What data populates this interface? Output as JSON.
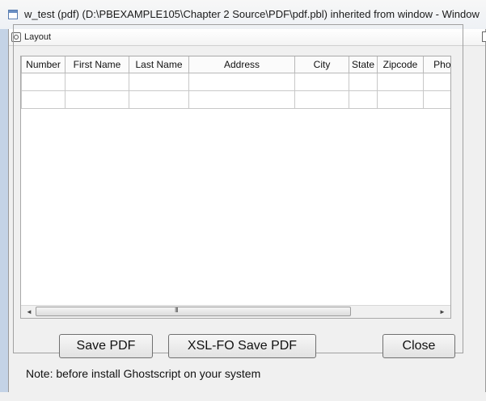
{
  "window": {
    "title": "w_test (pdf) (D:\\PBEXAMPLE105\\Chapter 2 Source\\PDF\\pdf.pbl) inherited from window - Window",
    "icon": "window-icon"
  },
  "layout_panel": {
    "title": "Layout",
    "icon": "layout-icon"
  },
  "grid": {
    "columns": [
      "Number",
      "First Name",
      "Last Name",
      "Address",
      "City",
      "State",
      "Zipcode",
      "Phone"
    ],
    "rows": [
      [
        "",
        "",
        "",
        "",
        "",
        "",
        "",
        ""
      ],
      [
        "",
        "",
        "",
        "",
        "",
        "",
        "",
        ""
      ]
    ],
    "scrollbar_grip": "III"
  },
  "buttons": {
    "save_pdf": "Save PDF",
    "xslfo_save_pdf": "XSL-FO Save PDF",
    "close": "Close"
  },
  "note": "Note: before install Ghostscript on your system"
}
